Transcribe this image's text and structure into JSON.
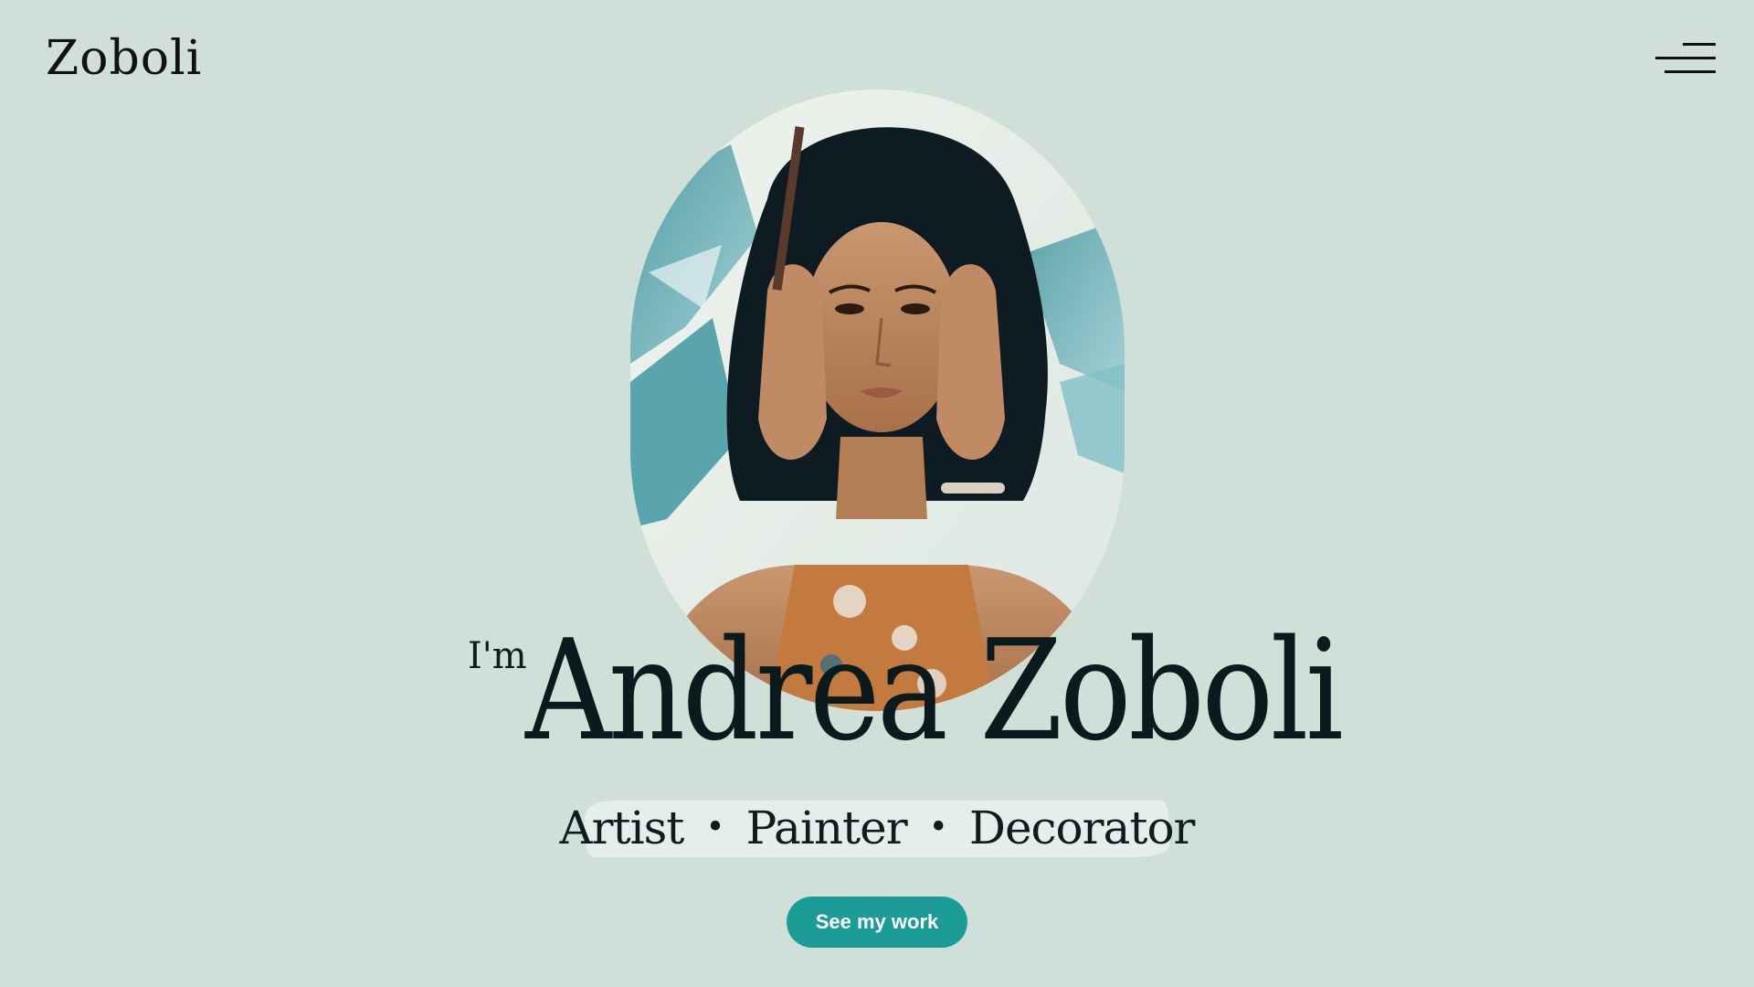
{
  "header": {
    "logo_text": "Zoboli",
    "menu_icon": "hamburger-menu-icon"
  },
  "hero": {
    "portrait_alt": "Portrait of a woman holding a paintbrush with hands on her face",
    "greeting": "I'm",
    "name": "Andrea Zoboli",
    "roles": [
      "Artist",
      "Painter",
      "Decorator"
    ],
    "role_separator": "•",
    "cta_label": "See my work"
  },
  "colors": {
    "background": "#d0dfd8",
    "accent": "#1b9c96",
    "text": "#0d1c1e"
  }
}
